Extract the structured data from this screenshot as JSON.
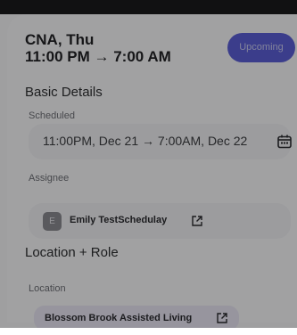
{
  "shift": {
    "title": "CNA, Thu",
    "time_range": "11:00 PM → 7:00 AM",
    "status": "Upcoming"
  },
  "basic_details": {
    "heading": "Basic Details",
    "scheduled_label": "Scheduled",
    "scheduled_value": "11:00PM, Dec 21 → 7:00AM, Dec 22",
    "assignee_label": "Assignee",
    "assignee_initial": "E",
    "assignee_name": "Emily TestSchedulay"
  },
  "location_role": {
    "heading": "Location + Role",
    "location_label": "Location",
    "location_name": "Blossom Brook Assisted Living"
  },
  "icons": {
    "calendar": "calendar-icon",
    "external_link": "external-link-icon"
  },
  "colors": {
    "accent": "#5b5fd6",
    "overlay": "rgba(0,0,0,0.35)"
  }
}
